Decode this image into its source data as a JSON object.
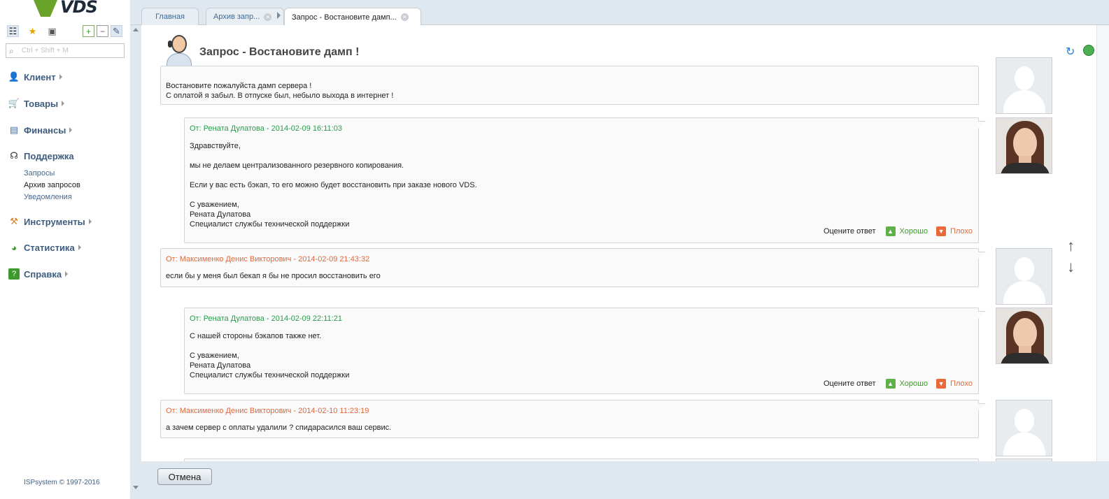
{
  "logo": {
    "text": "VDS"
  },
  "search": {
    "placeholder": "Ctrl + Shift + M"
  },
  "sidebar": {
    "items": [
      {
        "label": "Клиент"
      },
      {
        "label": "Товары"
      },
      {
        "label": "Финансы"
      },
      {
        "label": "Поддержка"
      },
      {
        "label": "Инструменты"
      },
      {
        "label": "Статистика"
      },
      {
        "label": "Справка"
      }
    ],
    "support_sub": [
      "Запросы",
      "Архив запросов",
      "Уведомления"
    ]
  },
  "copyright": "ISPsystem © 1997-2016",
  "tabs": [
    {
      "label": "Главная"
    },
    {
      "label": "Архив запр..."
    },
    {
      "label": "Запрос - Востановите дамп..."
    }
  ],
  "page": {
    "title": "Запрос - Востановите дамп !"
  },
  "messages": [
    {
      "from": "",
      "body": "Востановите пожалуйста дамп сервера !\nС оплатой я забыл. В отпуске был, небыло выхода в интернет !"
    },
    {
      "from": "От: Рената Дулатова - 2014-02-09 16:11:03",
      "body": "Здравствуйте,\n\nмы не делаем централизованного резервного копирования.\n\nЕсли у вас есть бэкап, то его можно будет восстановить при заказе нового VDS.\n\nС уважением,\nРената Дулатова\nСпециалист службы технической поддержки"
    },
    {
      "from": "От: Максименко Денис Викторович - 2014-02-09 21:43:32",
      "body": "если бы у меня был бекап я бы не просил восстановить его"
    },
    {
      "from": "От: Рената Дулатова - 2014-02-09 22:11:21",
      "body": "С нашей стороны бэкапов также нет.\n\nС уважением,\nРената Дулатова\nСпециалист службы технической поддержки"
    },
    {
      "from": "От: Максименко Денис Викторович - 2014-02-10 11:23:19",
      "body": "а зачем сервер с оплаты удалили ? спидарасился ваш сервис."
    }
  ],
  "rating": {
    "question": "Оцените ответ",
    "good": "Хорошо",
    "bad": "Плохо"
  },
  "footer": {
    "cancel_label": "Отмена"
  }
}
